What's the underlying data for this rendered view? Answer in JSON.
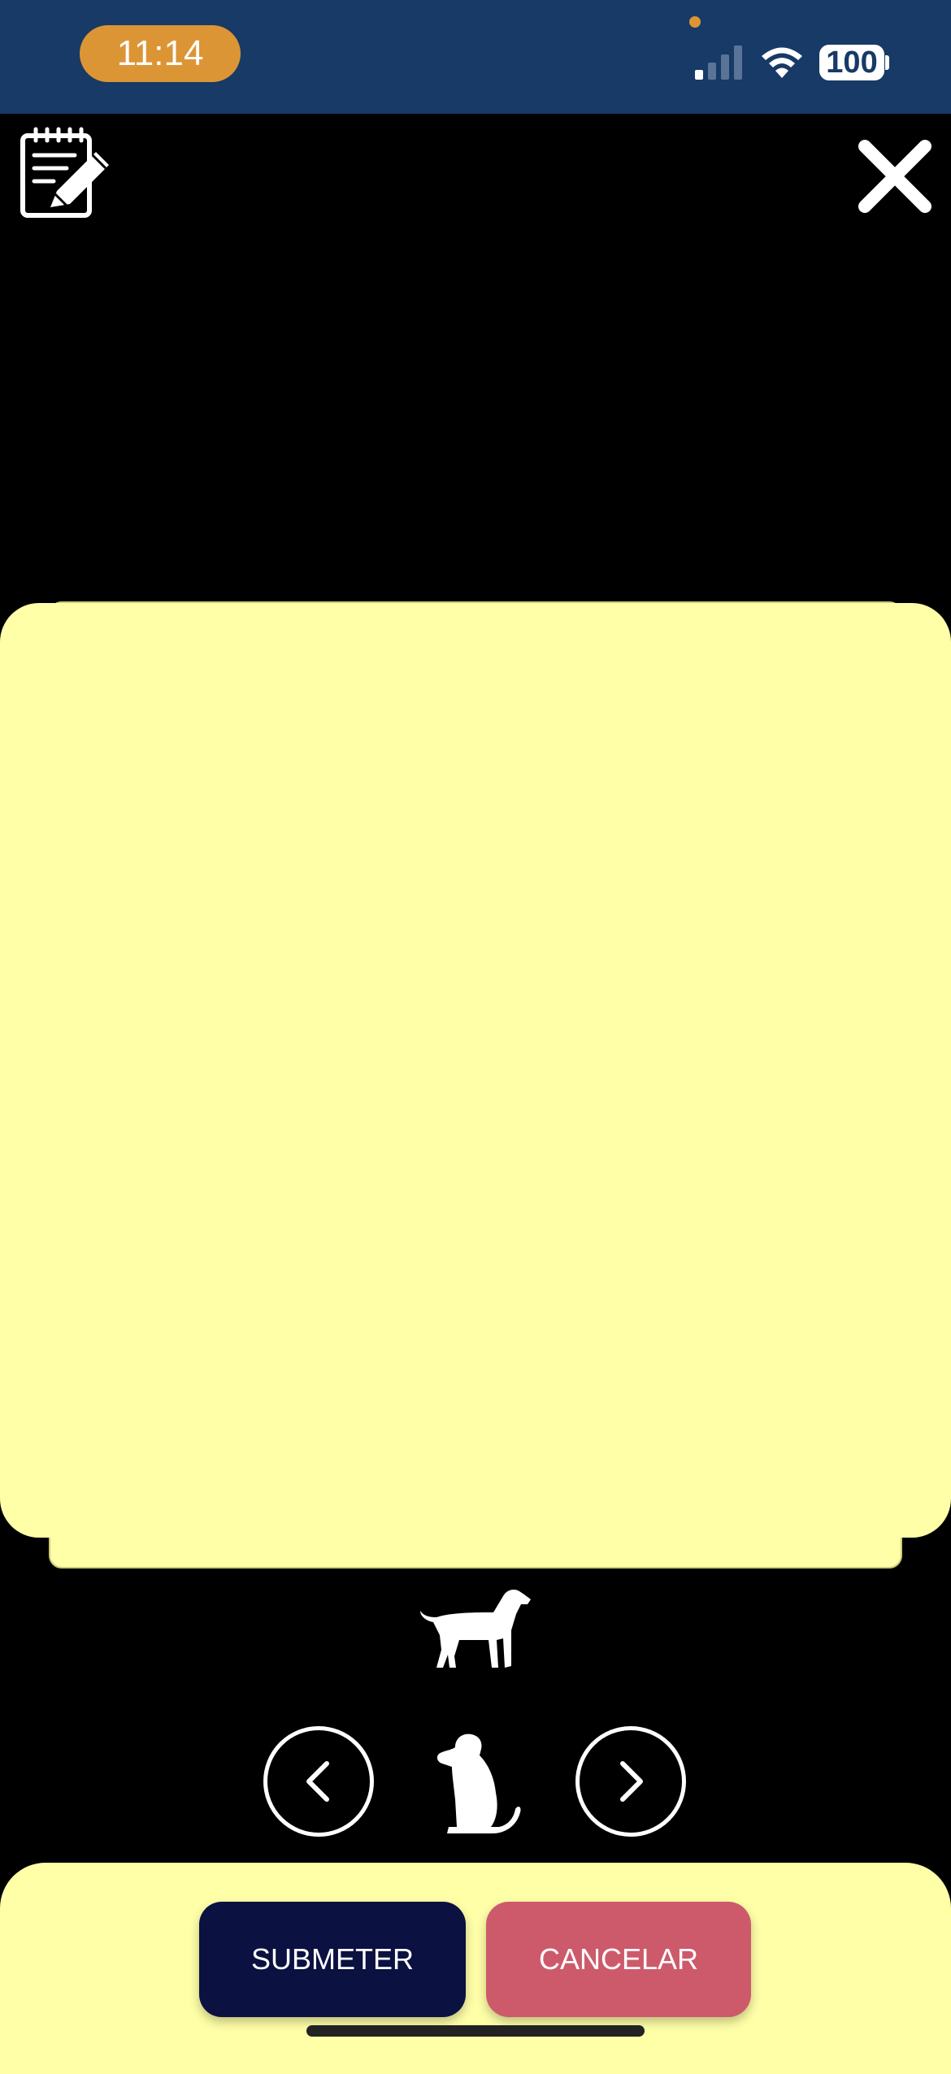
{
  "status_bar": {
    "time": "11:14",
    "battery": "100",
    "icons": [
      "cellular-signal-icon",
      "wifi-icon",
      "battery-icon"
    ]
  },
  "header": {
    "left_icon": "notepad-pencil-icon",
    "right_icon": "close-icon"
  },
  "card": {
    "color": "#ffffa8"
  },
  "carousel": {
    "top_icon": "dog-standing-icon",
    "center_icon": "dog-sitting-icon",
    "prev_icon": "chevron-left-icon",
    "next_icon": "chevron-right-icon"
  },
  "actions": {
    "submit_label": "SUBMETER",
    "cancel_label": "CANCELAR"
  },
  "colors": {
    "status_bar_bg": "#173a66",
    "time_pill": "#dc9535",
    "submit_bg": "#0b1140",
    "cancel_bg": "#cd5a6b",
    "panel_bg": "#ffffa8"
  }
}
